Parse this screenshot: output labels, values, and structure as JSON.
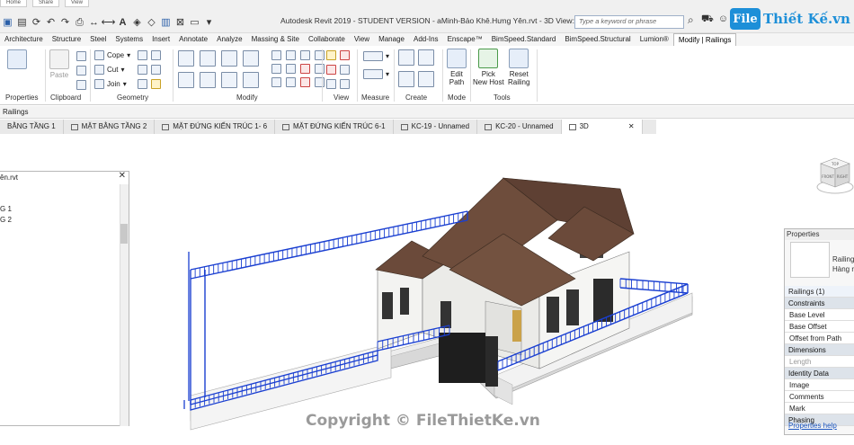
{
  "title_bar": {
    "top_tabs": [
      "Home",
      "Share",
      "View"
    ],
    "window_doc": "aMinh-Bảo Khê.Hưng Yên",
    "app_title": "Autodesk Revit 2019 - STUDENT VERSION - aMinh-Bảo Khê.Hưng Yên.rvt - 3D View: 3D",
    "search_placeholder": "Type a keyword or phrase",
    "logo_mark": "File",
    "logo_text": "Thiết Kế.vn"
  },
  "ribbon_tabs": [
    "Architecture",
    "Structure",
    "Steel",
    "Systems",
    "Insert",
    "Annotate",
    "Analyze",
    "Massing & Site",
    "Collaborate",
    "View",
    "Manage",
    "Add-Ins",
    "Enscape™",
    "BimSpeed.Standard",
    "BimSpeed.Structural",
    "Lumion®",
    "Modify | Railings"
  ],
  "ribbon": {
    "properties_label": "Properties",
    "clipboard": {
      "paste": "Paste",
      "label": "Clipboard"
    },
    "geometry": {
      "cope": "Cope",
      "cut": "Cut",
      "join": "Join",
      "label": "Geometry"
    },
    "modify_label": "Modify",
    "view_label": "View",
    "measure_label": "Measure",
    "create_label": "Create",
    "mode": {
      "edit_path": "Edit\nPath",
      "edit_path_l1": "Edit",
      "edit_path_l2": "Path",
      "label": "Mode"
    },
    "tools": {
      "pick_l1": "Pick",
      "pick_l2": "New Host",
      "reset_l1": "Reset",
      "reset_l2": "Railing",
      "label": "Tools"
    }
  },
  "context_bar": {
    "label": "Railings"
  },
  "view_tabs": [
    {
      "label": "BẰNG TẦNG 1"
    },
    {
      "label": "MẶT BẰNG TẦNG 2"
    },
    {
      "label": "MẶT ĐỨNG KIẾN TRÚC 1- 6"
    },
    {
      "label": "MẶT ĐỨNG KIẾN TRÚC 6-1"
    },
    {
      "label": "KC-19 - Unnamed"
    },
    {
      "label": "KC-20 - Unnamed"
    },
    {
      "label": "3D"
    }
  ],
  "project_browser": {
    "root": "ên.rvt",
    "items": [
      "G 1",
      "G 2"
    ]
  },
  "properties": {
    "header": "Properties",
    "type_l1": "Railing",
    "type_l2": "Hàng r",
    "selection": "Railings (1)",
    "rows": [
      {
        "kind": "cat",
        "label": "Constraints"
      },
      {
        "kind": "row",
        "label": "Base Level"
      },
      {
        "kind": "row",
        "label": "Base Offset"
      },
      {
        "kind": "row",
        "label": "Offset from Path"
      },
      {
        "kind": "cat",
        "label": "Dimensions"
      },
      {
        "kind": "dim",
        "label": "Length"
      },
      {
        "kind": "cat",
        "label": "Identity Data"
      },
      {
        "kind": "row",
        "label": "Image"
      },
      {
        "kind": "row",
        "label": "Comments"
      },
      {
        "kind": "row",
        "label": "Mark"
      },
      {
        "kind": "cat",
        "label": "Phasing"
      }
    ],
    "help": "Properties help"
  },
  "view_cube": {
    "face_top": "TOP",
    "face_left": "FRONT",
    "face_right": "RIGHT"
  },
  "watermark": "Copyright © FileThietKe.vn",
  "colors": {
    "railing_blue": "#1a3fd1",
    "roof_brown": "#6b4a3a",
    "logo_blue": "#1d8fd8"
  }
}
